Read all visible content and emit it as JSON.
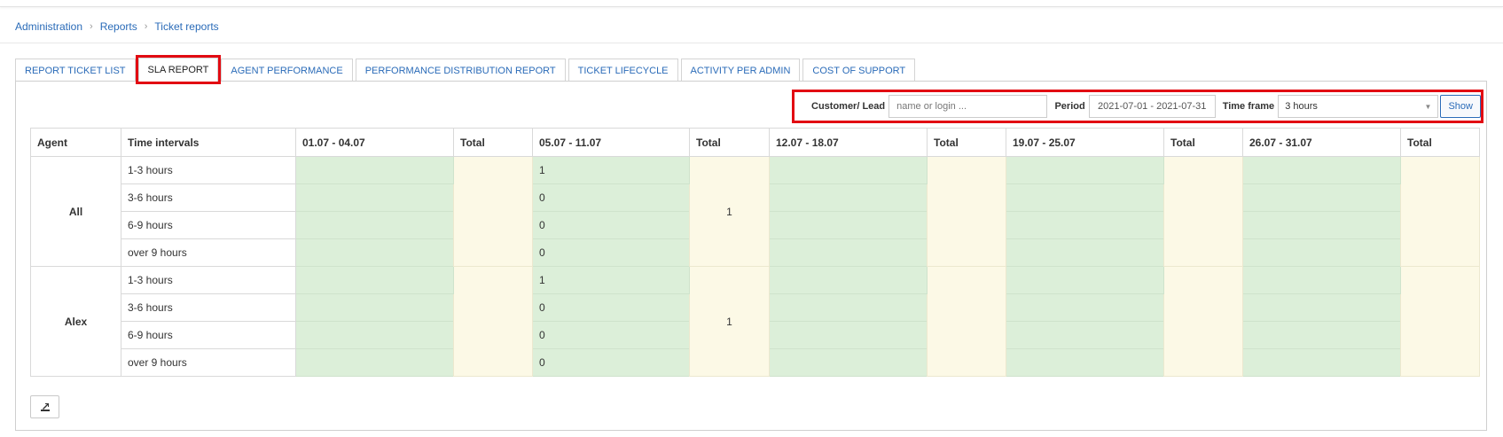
{
  "breadcrumb": [
    "Administration",
    "Reports",
    "Ticket reports"
  ],
  "tabs": [
    {
      "label": "REPORT TICKET LIST",
      "active": false
    },
    {
      "label": "SLA REPORT",
      "active": true
    },
    {
      "label": "AGENT PERFORMANCE",
      "active": false
    },
    {
      "label": "PERFORMANCE DISTRIBUTION REPORT",
      "active": false
    },
    {
      "label": "TICKET LIFECYCLE",
      "active": false
    },
    {
      "label": "ACTIVITY PER ADMIN",
      "active": false
    },
    {
      "label": "COST OF SUPPORT",
      "active": false
    }
  ],
  "filters": {
    "customer_label": "Customer/ Lead",
    "customer_placeholder": "name or login ...",
    "customer_value": "",
    "period_label": "Period",
    "period_value": "2021-07-01 - 2021-07-31",
    "timeframe_label": "Time frame",
    "timeframe_value": "3 hours",
    "show_label": "Show"
  },
  "table": {
    "headers": [
      "Agent",
      "Time intervals",
      "01.07 - 04.07",
      "Total",
      "05.07 - 11.07",
      "Total",
      "12.07 - 18.07",
      "Total",
      "19.07 - 25.07",
      "Total",
      "26.07 - 31.07",
      "Total"
    ],
    "groups": [
      {
        "agent": "All",
        "totals": [
          "",
          "1",
          "",
          "",
          ""
        ],
        "rows": [
          {
            "interval": "1-3 hours",
            "values": [
              "",
              "1",
              "",
              "",
              ""
            ]
          },
          {
            "interval": "3-6 hours",
            "values": [
              "",
              "0",
              "",
              "",
              ""
            ]
          },
          {
            "interval": "6-9 hours",
            "values": [
              "",
              "0",
              "",
              "",
              ""
            ]
          },
          {
            "interval": "over 9 hours",
            "values": [
              "",
              "0",
              "",
              "",
              ""
            ]
          }
        ]
      },
      {
        "agent": "Alex",
        "totals": [
          "",
          "1",
          "",
          "",
          ""
        ],
        "rows": [
          {
            "interval": "1-3 hours",
            "values": [
              "",
              "1",
              "",
              "",
              ""
            ]
          },
          {
            "interval": "3-6 hours",
            "values": [
              "",
              "0",
              "",
              "",
              ""
            ]
          },
          {
            "interval": "6-9 hours",
            "values": [
              "",
              "0",
              "",
              "",
              ""
            ]
          },
          {
            "interval": "over 9 hours",
            "values": [
              "",
              "0",
              "",
              "",
              ""
            ]
          }
        ]
      }
    ]
  },
  "icons": {
    "export": "export-icon",
    "breadcrumb_separator": "chevron-right-icon",
    "select": "caret-down-icon"
  },
  "colors": {
    "link": "#2a6bb8",
    "highlight": "#e20b12",
    "period_cell": "#dcefd9",
    "total_cell": "#fcf9e6"
  }
}
